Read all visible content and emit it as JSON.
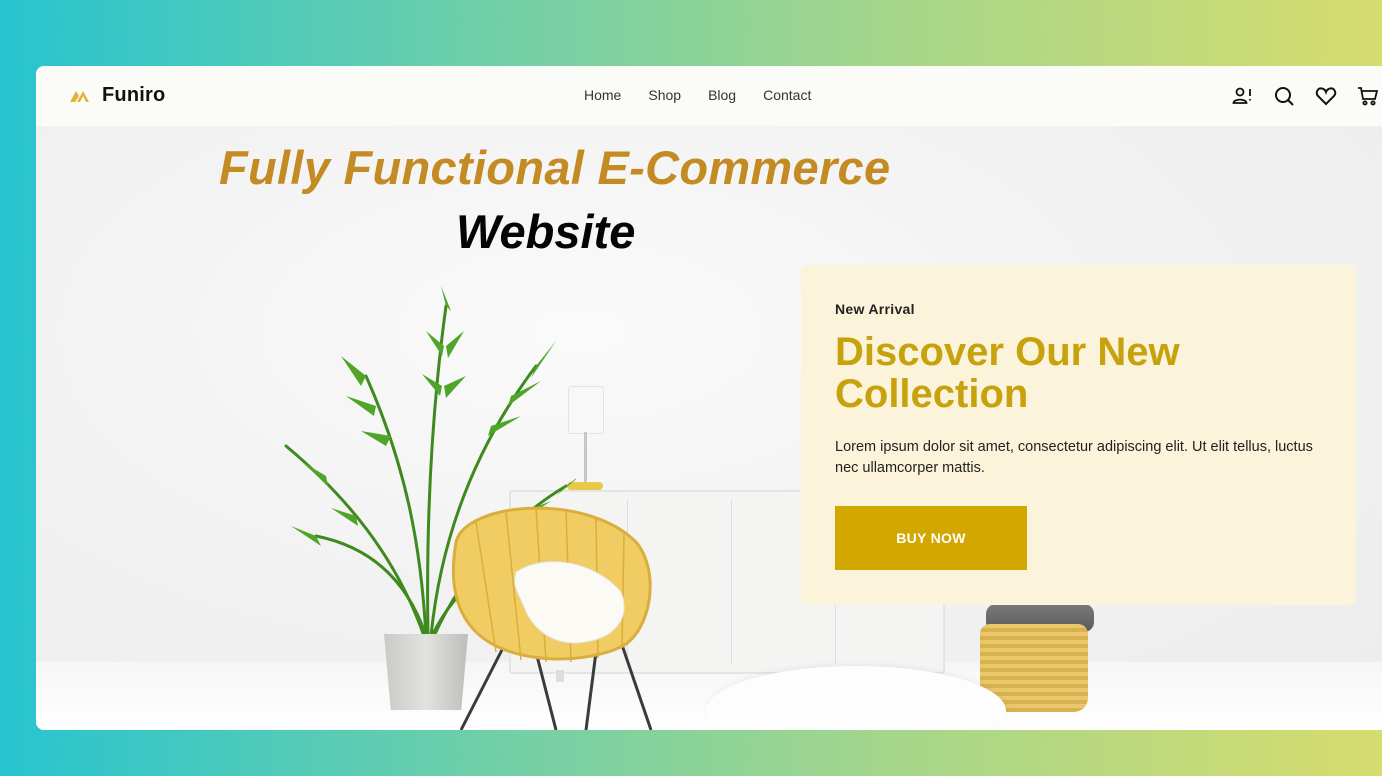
{
  "brand": {
    "name": "Funiro",
    "logo_icon": "funiro-logo-icon",
    "accent": "#e0b43a"
  },
  "nav": {
    "items": [
      "Home",
      "Shop",
      "Blog",
      "Contact"
    ]
  },
  "header_icons": [
    "account-alert-icon",
    "search-icon",
    "heart-icon",
    "cart-icon"
  ],
  "promo": {
    "line1": "Fully Functional E-Commerce",
    "line2": "Website",
    "line1_color": "#c48b25",
    "line2_color": "#050505"
  },
  "hero_card": {
    "eyebrow": "New Arrival",
    "headline": "Discover Our New Collection",
    "description": "Lorem ipsum dolor sit amet, consectetur adipiscing elit. Ut elit tellus, luctus nec ullamcorper mattis.",
    "button_label": "BUY NOW",
    "bg_color": "#fcf3db",
    "headline_color": "#c7a20d",
    "button_color": "#d2a800"
  }
}
